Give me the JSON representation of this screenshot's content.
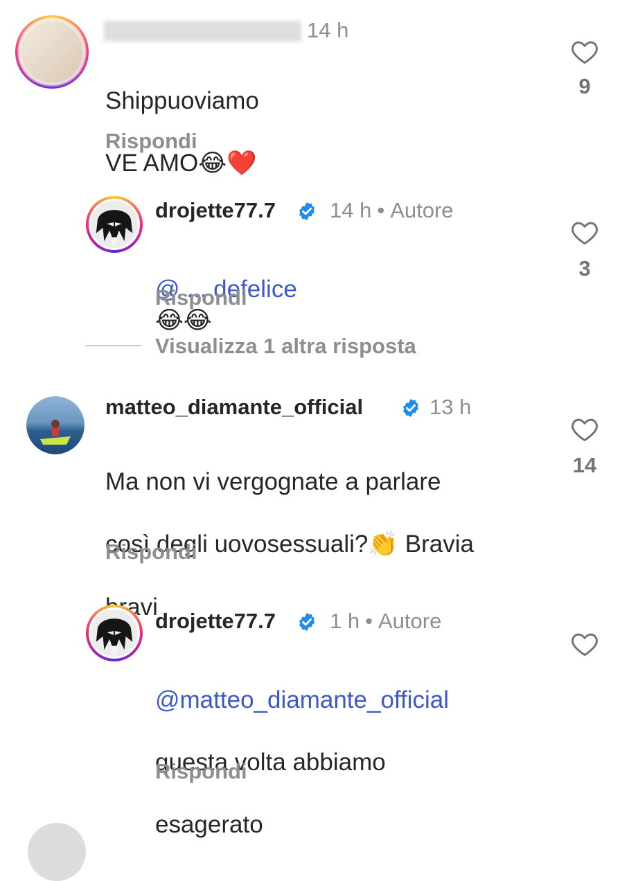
{
  "comments": [
    {
      "username": "",
      "time": "14 h",
      "text_line1": "Shippuoviamo",
      "text_line2": "VE AMO",
      "emoji": "😂❤️",
      "reply": "Rispondi",
      "likes": "9"
    },
    {
      "username": "drojette77.7",
      "time": "14 h",
      "author_badge": "Autore",
      "mention": "@ ... defelice",
      "emoji": "😂😂",
      "reply": "Rispondi",
      "likes": "3"
    },
    {
      "view_more": "Visualizza 1 altra risposta"
    },
    {
      "username": "matteo_diamante_official",
      "time": "13 h",
      "text_line1": "Ma non vi vergognate a parlare",
      "text_line2": "così degli uovosessuali?",
      "emoji": "👏",
      "text_line2_tail": " Bravia",
      "text_line3": "bravi",
      "reply": "Rispondi",
      "likes": "14"
    },
    {
      "username": "drojette77.7",
      "time": "1 h",
      "author_badge": "Autore",
      "mention": "@matteo_diamante_official",
      "text_line1": "questa volta abbiamo",
      "text_line2": "esagerato",
      "reply": "Rispondi",
      "likes": ""
    }
  ],
  "icons": {
    "heart": "heart-outline-icon",
    "verified": "verified-badge-icon"
  },
  "colors": {
    "mention": "#3d59c9",
    "muted": "#8e8e8e",
    "verified": "#1f8bf0"
  }
}
